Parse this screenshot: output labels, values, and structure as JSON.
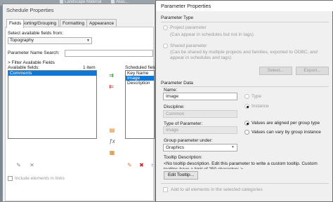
{
  "background": {
    "tabs": [
      "Landscape Material",
      "Alias..."
    ]
  },
  "schedule": {
    "title": "Schedule Properties",
    "tabs": [
      {
        "label": "Fields",
        "active": true
      },
      {
        "label": "Sorting/Grouping",
        "active": false
      },
      {
        "label": "Formatting",
        "active": false
      },
      {
        "label": "Appearance",
        "active": false
      }
    ],
    "select_from_label": "Select available fields from:",
    "select_from_value": "Topography",
    "param_search_label": "Parameter Name Search:",
    "filter_label": "Filter Available Fields",
    "available_label": "Available fields:",
    "available_count": "1 item",
    "available_items": [
      {
        "label": "Comments",
        "selected": true
      }
    ],
    "scheduled_label": "Scheduled fields (",
    "scheduled_items": [
      {
        "label": "Key Name",
        "selected": false
      },
      {
        "label": "Image",
        "selected": true
      },
      {
        "label": "Description",
        "selected": false
      }
    ],
    "include_links_label": "Include elements in links"
  },
  "param": {
    "title": "Parameter Properties",
    "type_header": "Parameter Type",
    "project_param_label": "Project parameter",
    "project_param_desc": "(Can appear in schedules but not in tags)",
    "shared_param_label": "Shared parameter",
    "shared_param_desc": "(Can be shared by multiple projects and families, exported to ODBC, and appear in schedules and tags)",
    "select_btn": "Select...",
    "export_btn": "Export...",
    "data_header": "Parameter Data",
    "name_label": "Name:",
    "name_value": "Image",
    "type_radio": "Type",
    "instance_radio": "Instance",
    "discipline_label": "Discipline:",
    "discipline_value": "Common",
    "type_of_param_label": "Type of Parameter:",
    "type_of_param_value": "Image",
    "aligned_label": "Values are aligned per group type",
    "vary_label": "Values can vary by group instance",
    "group_label": "Group parameter under:",
    "group_value": "Graphics",
    "tooltip_label": "Tooltip Description:",
    "tooltip_text": "<No tooltip description. Edit this parameter to write a custom tooltip. Custom tooltips have a limit of 250 characters.>",
    "edit_tooltip_btn": "Edit Tooltip...",
    "add_all_label": "Add to all elements in the selected categories"
  }
}
